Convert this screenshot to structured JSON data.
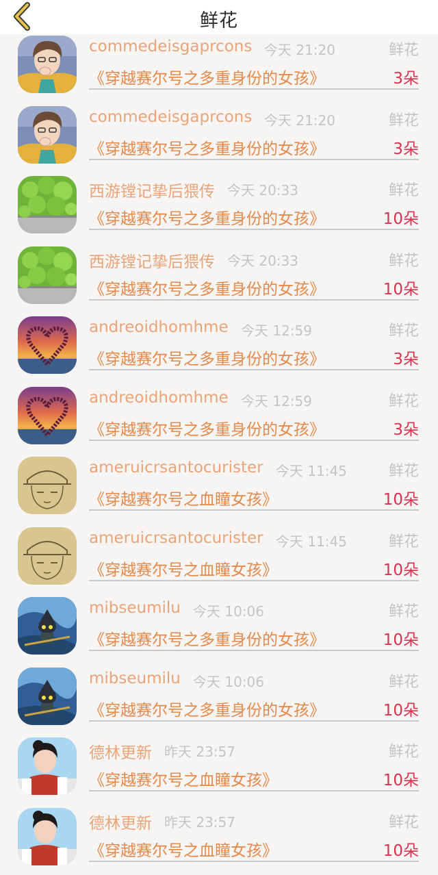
{
  "header": {
    "title": "鲜花",
    "back_icon": "chevron-left-icon",
    "accent": "#e8c24a"
  },
  "rows": [
    {
      "user": "commedeisgaprcons",
      "time": "今天 21:20",
      "kind": "鲜花",
      "book": "《穿越赛尔号之多重身份的女孩》",
      "count": "3朵",
      "avatar": "anime-boy"
    },
    {
      "user": "commedeisgaprcons",
      "time": "今天 21:20",
      "kind": "鲜花",
      "book": "《穿越赛尔号之多重身份的女孩》",
      "count": "3朵",
      "avatar": "anime-boy"
    },
    {
      "user": "西游镗记挚后猥传",
      "time": "今天 20:33",
      "kind": "鲜花",
      "book": "《穿越赛尔号之多重身份的女孩》",
      "count": "10朵",
      "avatar": "clover"
    },
    {
      "user": "西游镗记挚后猥传",
      "time": "今天 20:33",
      "kind": "鲜花",
      "book": "《穿越赛尔号之多重身份的女孩》",
      "count": "10朵",
      "avatar": "clover"
    },
    {
      "user": "andreoidhomhme",
      "time": "今天 12:59",
      "kind": "鲜花",
      "book": "《穿越赛尔号之多重身份的女孩》",
      "count": "3朵",
      "avatar": "heart-sunset"
    },
    {
      "user": "andreoidhomhme",
      "time": "今天 12:59",
      "kind": "鲜花",
      "book": "《穿越赛尔号之多重身份的女孩》",
      "count": "3朵",
      "avatar": "heart-sunset"
    },
    {
      "user": "ameruicrsantocurister",
      "time": "今天 11:45",
      "kind": "鲜花",
      "book": "《穿越赛尔号之血瞳女孩》",
      "count": "10朵",
      "avatar": "sketch"
    },
    {
      "user": "ameruicrsantocurister",
      "time": "今天 11:45",
      "kind": "鲜花",
      "book": "《穿越赛尔号之血瞳女孩》",
      "count": "10朵",
      "avatar": "sketch"
    },
    {
      "user": "mibseumilu",
      "time": "今天 10:06",
      "kind": "鲜花",
      "book": "《穿越赛尔号之多重身份的女孩》",
      "count": "10朵",
      "avatar": "game-char"
    },
    {
      "user": "mibseumilu",
      "time": "今天 10:06",
      "kind": "鲜花",
      "book": "《穿越赛尔号之多重身份的女孩》",
      "count": "10朵",
      "avatar": "game-char"
    },
    {
      "user": "德林更新",
      "time": "昨天 23:57",
      "kind": "鲜花",
      "book": "《穿越赛尔号之血瞳女孩》",
      "count": "10朵",
      "avatar": "girl"
    },
    {
      "user": "德林更新",
      "time": "昨天 23:57",
      "kind": "鲜花",
      "book": "《穿越赛尔号之血瞳女孩》",
      "count": "10朵",
      "avatar": "girl"
    }
  ]
}
